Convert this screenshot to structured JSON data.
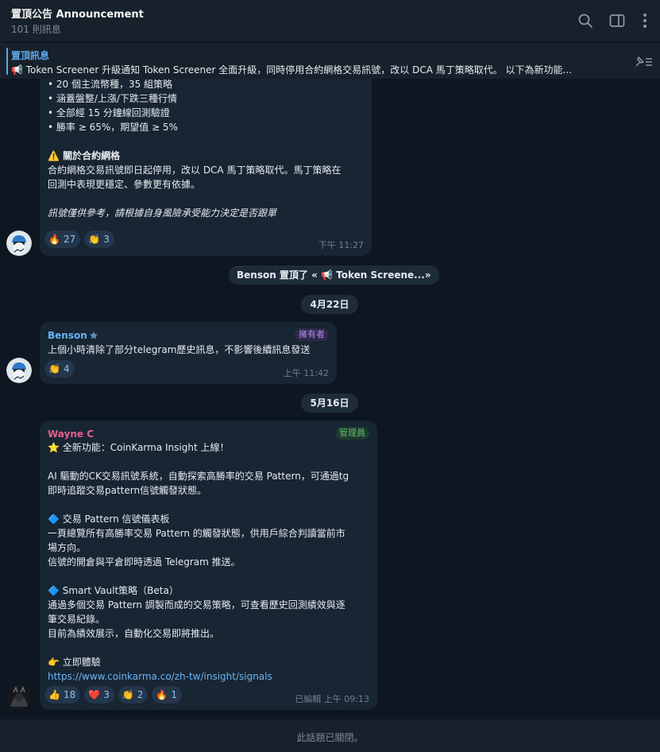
{
  "header": {
    "title": "置頂公告 Announcement",
    "subtitle": "101 則訊息",
    "icons": [
      "search-icon",
      "sidebar-toggle-icon",
      "more-vertical-icon"
    ]
  },
  "pinned": {
    "label": "置頂訊息",
    "text": "📢 Token Screener 升級通知  Token Screener 全面升級，同時停用合約網格交易訊號，改以 DCA 馬丁策略取代。 以下為新功能..."
  },
  "messages": {
    "m1": {
      "lines": [
        "• 20 個主流幣種，35 組策略",
        "• 涵蓋盤整/上漲/下跌三種行情",
        "• 全部經 15 分鐘線回測驗證",
        "• 勝率 ≥ 65%，期望值 ≥ 5%"
      ],
      "warn_title": "⚠️ 關於合約網格",
      "warn_body_1": "合約網格交易訊號即日起停用，改以 DCA 馬丁策略取代。馬丁策略在",
      "warn_body_2": "回測中表現更穩定、參數更有依據。",
      "disclaimer": "訊號僅供參考，請根據自身風險承受能力決定是否跟單",
      "reactions": [
        {
          "emoji": "🔥",
          "count": "27"
        },
        {
          "emoji": "👏",
          "count": "3"
        }
      ],
      "time": "下午 11:27"
    },
    "service_pin": "Benson 置頂了 « 📢 Token Screene...»",
    "date_1": "4月22日",
    "m2": {
      "sender": "Benson",
      "role": "擁有者",
      "text": "上個小時清除了部分telegram歷史訊息，不影響後續訊息發送",
      "reactions": [
        {
          "emoji": "👏",
          "count": "4"
        }
      ],
      "time": "上午 11:42"
    },
    "date_2": "5月16日",
    "m3": {
      "sender": "Wayne C",
      "role": "管理員",
      "title": "⭐ 全新功能：CoinKarma Insight 上線！",
      "p1_1": "AI 驅動的CK交易訊號系統，自動探索高勝率的交易 Pattern，可通過tg",
      "p1_2": "即時追蹤交易pattern信號觸發狀態。",
      "s1_title": "🔷 交易 Pattern 信號儀表板",
      "s1_1": "一頁總覽所有高勝率交易 Pattern 的觸發狀態，供用戶綜合判讀當前市",
      "s1_2": "場方向。",
      "s1_3": "信號的開倉與平倉即時透過 Telegram 推送。",
      "s2_title": "🔷 Smart Vault策略（Beta）",
      "s2_1": "通過多個交易 Pattern 調製而成的交易策略，可查看歷史回測績效與逐",
      "s2_2": "筆交易紀錄。",
      "s2_3": "目前為績效展示，自動化交易即將推出。",
      "cta": "👉 立即體驗",
      "link": "https://www.coinkarma.co/zh-tw/insight/signals",
      "reactions": [
        {
          "emoji": "👍",
          "count": "18"
        },
        {
          "emoji": "❤️",
          "count": "3"
        },
        {
          "emoji": "👏",
          "count": "2"
        },
        {
          "emoji": "🔥",
          "count": "1"
        }
      ],
      "time": "已編輯 上午 09:13"
    }
  },
  "footer": {
    "text": "此話題已關閉。"
  },
  "colors": {
    "background": "#0e1621",
    "panel": "#17212b",
    "bubble": "#182533",
    "accent": "#5fa8e8",
    "owner_name": "#6ab3f3",
    "admin_name": "#e65e8f",
    "owner_badge": "#b48ae8",
    "admin_badge": "#5dbb6a"
  }
}
